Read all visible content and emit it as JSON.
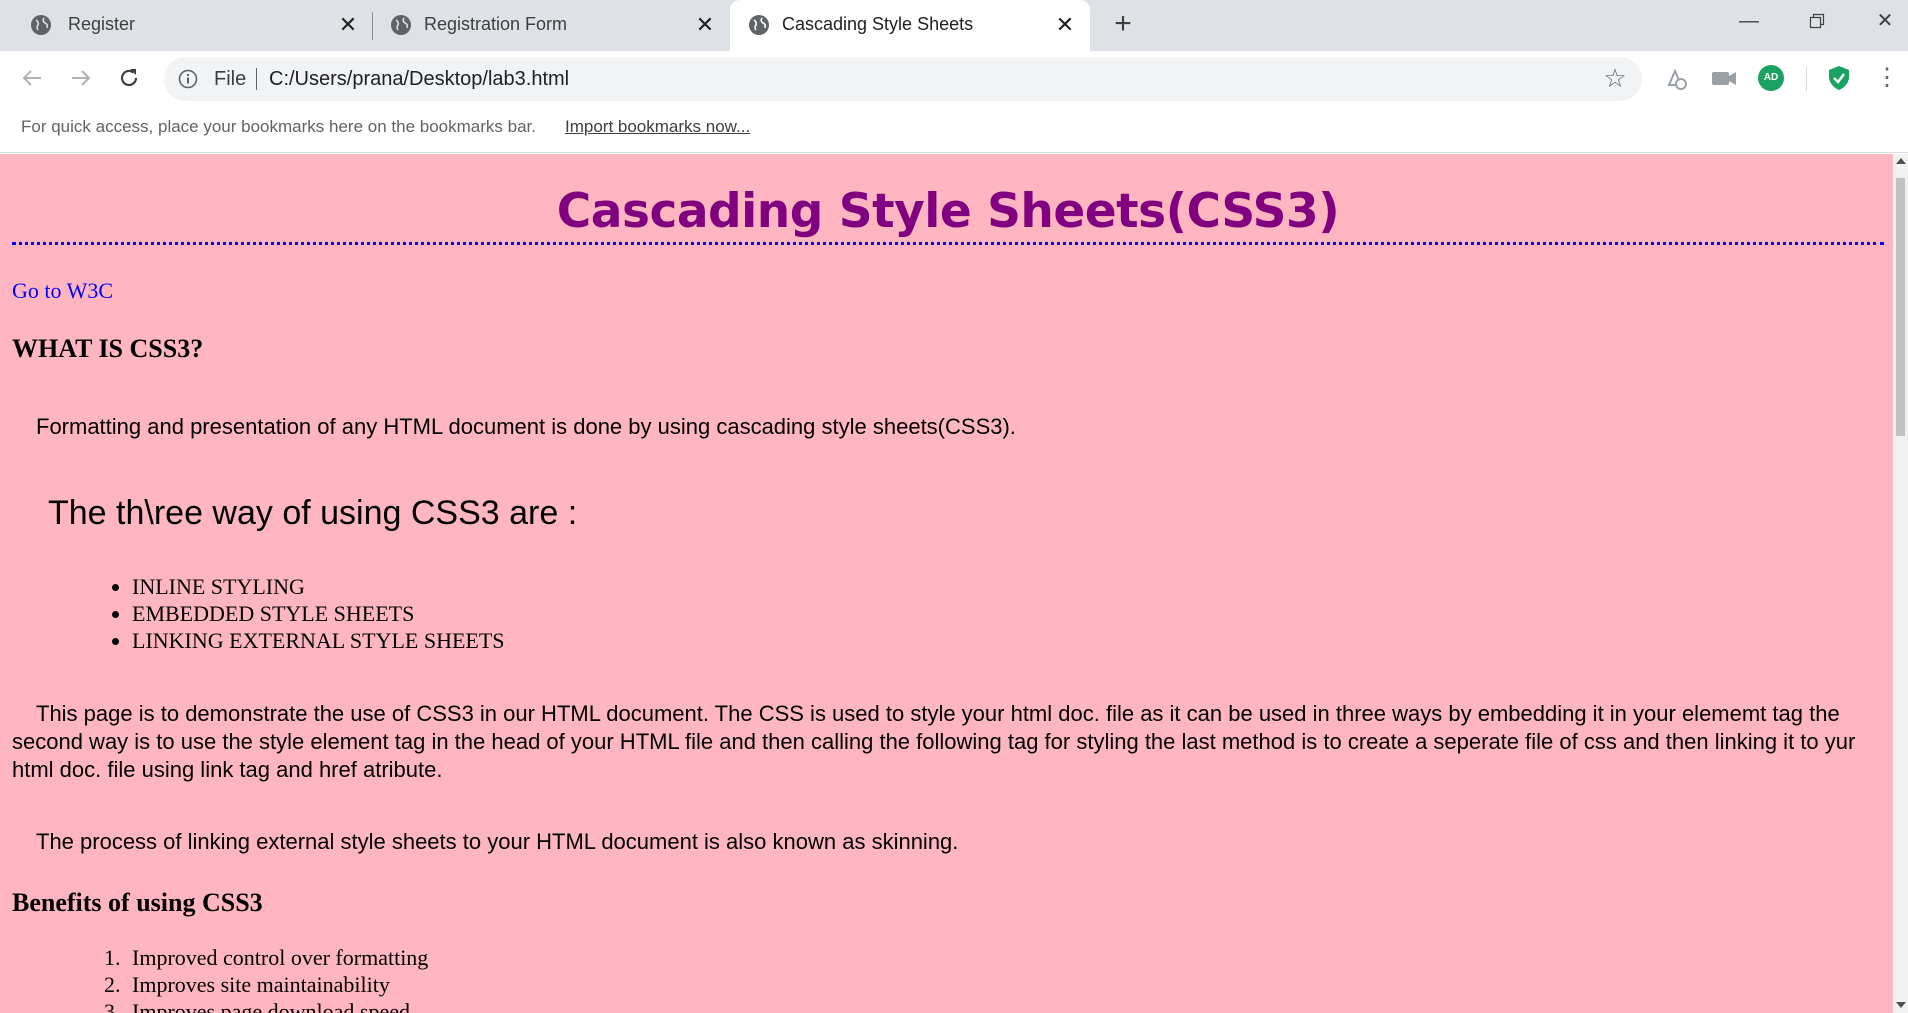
{
  "browser": {
    "tabs": [
      {
        "label": "Register",
        "active": false
      },
      {
        "label": "Registration Form",
        "active": false
      },
      {
        "label": "Cascading Style Sheets",
        "active": true
      }
    ],
    "omnibox": {
      "scheme_label": "File",
      "url": "C:/Users/prana/Desktop/lab3.html"
    },
    "extension_badge": "AD",
    "bookmarks_bar": {
      "message": "For quick access, place your bookmarks here on the bookmarks bar.",
      "import_link": "Import bookmarks now..."
    }
  },
  "page": {
    "background": "#ffb6c1",
    "title": "Cascading Style Sheets(CSS3)",
    "title_color": "#800080",
    "w3c_link": "Go to W3C",
    "what_heading": "WHAT IS CSS3?",
    "intro": "Formatting and presentation of any HTML document is done by using cascading style sheets(CSS3).",
    "ways_heading": "The th\\ree way of using CSS3 are :",
    "ways": [
      "INLINE STYLING",
      "EMBEDDED STYLE SHEETS",
      "LINKING EXTERNAL STYLE SHEETS"
    ],
    "demo_paragraph": "This page is to demonstrate the use of CSS3 in our HTML document. The CSS is used to style your html doc. file as it can be used in three ways by embedding it in your elememt tag the second way is to use the style element tag in the head of your HTML file and then calling the following tag for styling the last method is to create a seperate file of css and then linking it to yur html doc. file using link tag and href atribute.",
    "skinning_paragraph": "The process of linking external style sheets to your HTML document is also known as skinning.",
    "benefits_heading": "Benefits of using CSS3",
    "benefits": [
      "Improved control over formatting",
      "Improves site maintainability",
      "Improves page download speed"
    ]
  }
}
